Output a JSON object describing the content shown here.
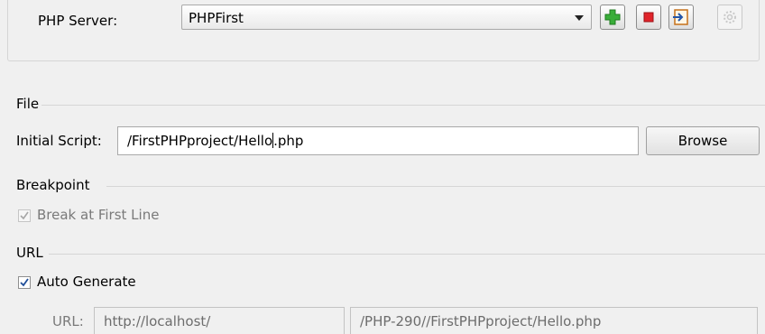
{
  "server": {
    "label": "PHP Server:",
    "selected": "PHPFirst",
    "buttons": [
      "add-icon",
      "stop-icon",
      "import-icon",
      "settings-icon"
    ]
  },
  "file": {
    "title": "File",
    "label": "Initial Script:",
    "value_before_caret": "/FirstPHPproject/Hello",
    "value_after_caret": ".php",
    "browse": "Browse"
  },
  "breakpoint": {
    "title": "Breakpoint",
    "checkbox_label": "Break at First Line",
    "checked": true,
    "enabled": false
  },
  "url": {
    "title": "URL",
    "auto_label": "Auto Generate",
    "auto_checked": true,
    "url_label": "URL:",
    "base": "http://localhost/",
    "path": "/PHP-290//FirstPHPproject/Hello.php"
  },
  "colors": {
    "add_green": "#2e9a2e",
    "stop_red": "#e0242a",
    "import_orange": "#d27a1c",
    "check_blue": "#1f4e99"
  }
}
